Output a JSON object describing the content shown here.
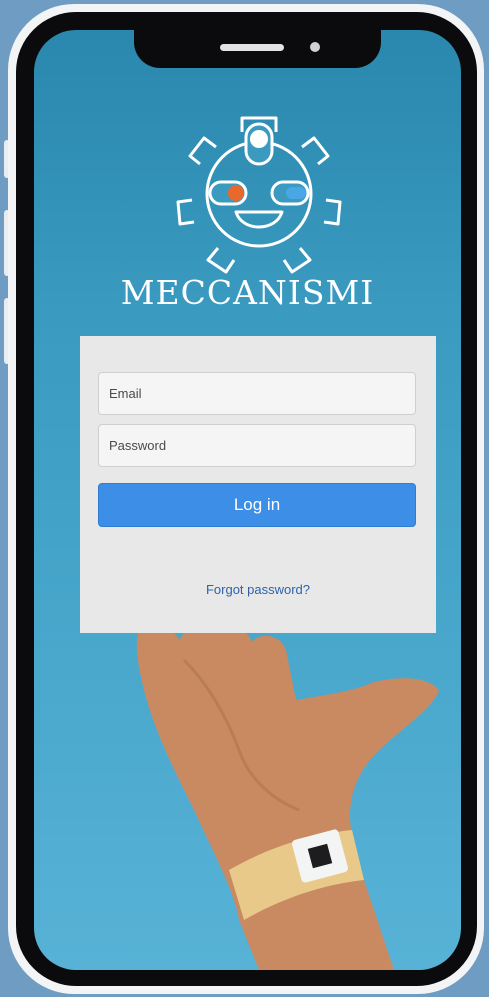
{
  "app": {
    "brand_name": "MECCANISMI"
  },
  "login": {
    "email_placeholder": "Email",
    "password_placeholder": "Password",
    "submit_label": "Log in",
    "forgot_label": "Forgot password?"
  },
  "colors": {
    "accent": "#3d8ee6",
    "link": "#2c63a8",
    "screen_background": "#3a9ac0",
    "card_background": "#e8e8e8",
    "logo_left_dot": "#e8692a",
    "logo_right_pill": "#4aa7e6"
  },
  "icons": [
    "gear-robot-logo-icon"
  ]
}
